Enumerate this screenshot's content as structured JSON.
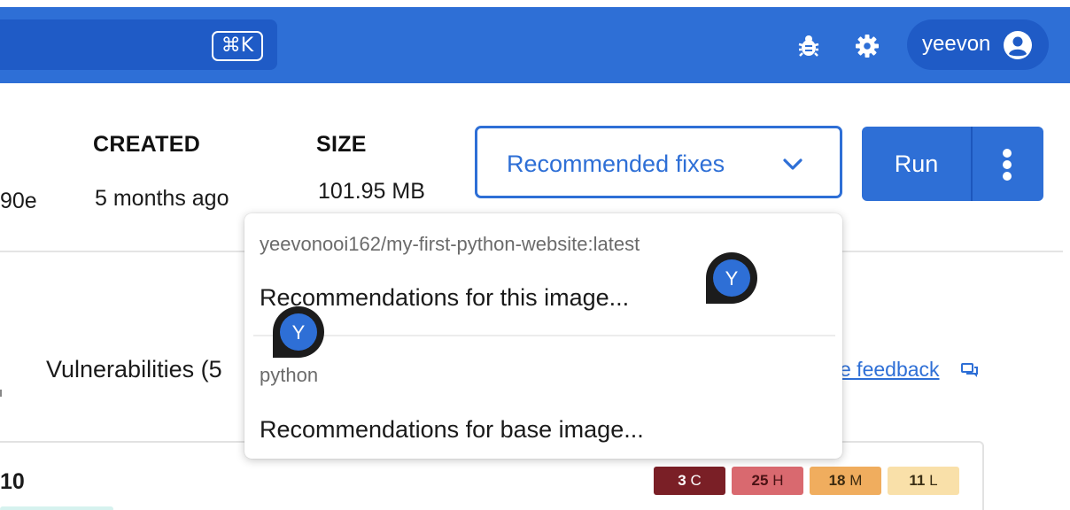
{
  "topbar": {
    "search_shortcut": "⌘K",
    "icons": [
      "bug-icon",
      "gear-icon",
      "user-circle-icon"
    ],
    "user": {
      "name": "yeevon"
    },
    "colors": {
      "bar": "#2e6fd6",
      "chip": "#1f5bc6"
    }
  },
  "details": {
    "digest_fragment": "90e",
    "created": {
      "label": "CREATED",
      "value": "5 months ago"
    },
    "size": {
      "label": "SIZE",
      "value": "101.95 MB"
    }
  },
  "actions": {
    "fixes_label": "Recommended fixes",
    "run_label": "Run"
  },
  "menu": {
    "image_group": "yeevonooi162/my-first-python-website:latest",
    "image_item": "Recommendations for this image...",
    "base_group": "python",
    "base_item": "Recommendations for base image..."
  },
  "vulnerabilities": {
    "title": "Vulnerabilities (5",
    "feedback_link": "e feedback"
  },
  "package": {
    "name": "10",
    "severity": [
      {
        "count": "3",
        "level": "C",
        "bg": "#7a1f26",
        "fg": "#ffffff"
      },
      {
        "count": "25",
        "level": "H",
        "bg": "#d9696f",
        "fg": "#4a1214"
      },
      {
        "count": "18",
        "level": "M",
        "bg": "#f0ad5e",
        "fg": "#3b2a10"
      },
      {
        "count": "11",
        "level": "L",
        "bg": "#f9e0a9",
        "fg": "#3b2f15"
      }
    ]
  },
  "cursors": [
    {
      "initial": "Y"
    },
    {
      "initial": "Y"
    }
  ]
}
